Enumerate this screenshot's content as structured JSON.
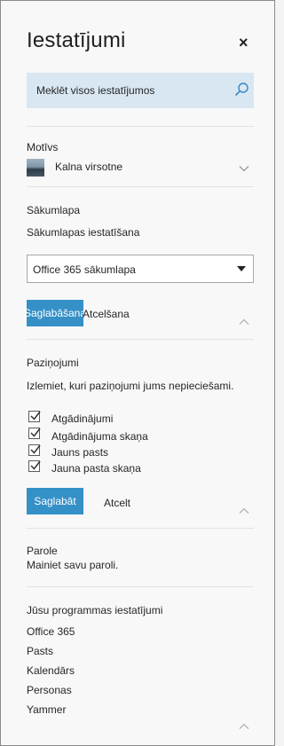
{
  "header": {
    "title": "Iestatījumi",
    "close_glyph": "×"
  },
  "search": {
    "placeholder": "Meklēt visos iestatījumos"
  },
  "theme": {
    "heading": "Motīvs",
    "current": "Kalna virsotne"
  },
  "home": {
    "heading": "Sākumlapa",
    "subheading": "Sākumlapas iestatīšana",
    "select_value": "Office 365 sākumlapa",
    "save_label": "Saglabāšana",
    "cancel_label": "Atcelšana"
  },
  "notifications": {
    "heading": "Paziņojumi",
    "description": "Izlemiet, kuri paziņojumi jums nepieciešami.",
    "options": [
      {
        "label": "Atgādinājumi",
        "checked": true
      },
      {
        "label": "Atgādinājuma skaņa",
        "checked": true
      },
      {
        "label": "Jauns pasts",
        "checked": true
      },
      {
        "label": "Jauna pasta skaņa",
        "checked": true
      }
    ],
    "save_label": "Saglabāt",
    "cancel_label": "Atcelt"
  },
  "password": {
    "heading": "Parole",
    "link": "Mainiet savu paroli."
  },
  "apps": {
    "heading": "Jūsu programmas iestatījumi",
    "items": [
      "Office 365",
      "Pasts",
      "Kalendārs",
      "Personas",
      "Yammer"
    ]
  },
  "colors": {
    "accent": "#3490c7",
    "search_bg": "#d8e7f2"
  }
}
